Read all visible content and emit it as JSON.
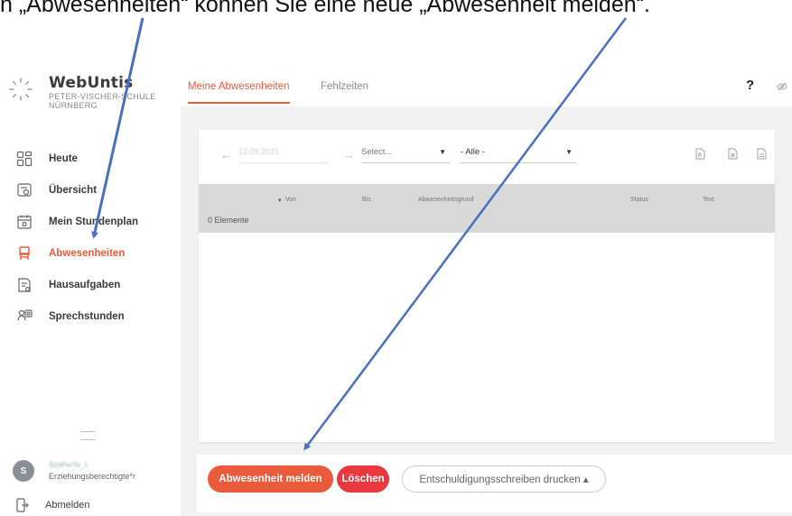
{
  "caption": {
    "text": "n „Abwesenheiten“ können Sie eine neue „Abwesenheit melden“."
  },
  "sidebar": {
    "logo_title": "WebUntis",
    "logo_sub_line1": "PETER-VISCHER-SCHULE",
    "logo_sub_line2": "NÜRNBERG",
    "items": [
      {
        "label": "Heute",
        "icon": "dashboard-icon",
        "active": false
      },
      {
        "label": "Übersicht",
        "icon": "overview-icon",
        "active": false
      },
      {
        "label": "Mein Stundenplan",
        "icon": "calendar-icon",
        "active": false
      },
      {
        "label": "Abwesenheiten",
        "icon": "chair-icon",
        "active": true
      },
      {
        "label": "Hausaufgaben",
        "icon": "homework-icon",
        "active": false
      },
      {
        "label": "Sprechstunden",
        "icon": "consultation-icon",
        "active": false
      }
    ],
    "user": {
      "initial": "S",
      "name": "SchPerTe_1",
      "role": "Erziehungsberechtigte*r"
    },
    "logout_label": "Abmelden"
  },
  "tabs": [
    {
      "label": "Meine Abwesenheiten",
      "active": true
    },
    {
      "label": "Fehlzeiten",
      "active": false
    }
  ],
  "help_label": "?",
  "toolbar": {
    "date_value": "12.09.2021",
    "select_placeholder": "Select...",
    "filter_value": "- Alle -"
  },
  "table": {
    "columns": [
      "Von",
      "Bis",
      "Abwesenheitsgrund",
      "Status",
      "Text"
    ],
    "count_label": "0 Elemente"
  },
  "actions": {
    "report_label": "Abwesenheit melden",
    "delete_label": "Löschen",
    "print_label": "Entschuldigungsschreiben drucken ▴"
  },
  "colors": {
    "accent": "#e95b3a",
    "danger": "#e8393f",
    "annotation_arrow": "#4a6fc0"
  }
}
